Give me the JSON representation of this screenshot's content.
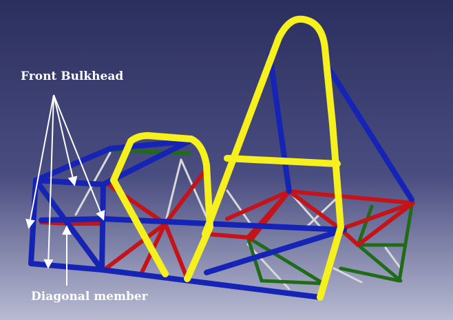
{
  "labels": {
    "front_bulkhead": "Front Bulkhead",
    "diagonal_member": "Diagonal member"
  },
  "colors": {
    "background_top": "#2b2f5e",
    "background_bottom": "#b8bbd2",
    "roll_hoop": "#f5f01e",
    "main_frame": "#1524b4",
    "bracing": "#c4141a",
    "lower_bracing": "#1f6b17",
    "thin_members": "#d8d8d8",
    "annotation": "#ffffff"
  }
}
